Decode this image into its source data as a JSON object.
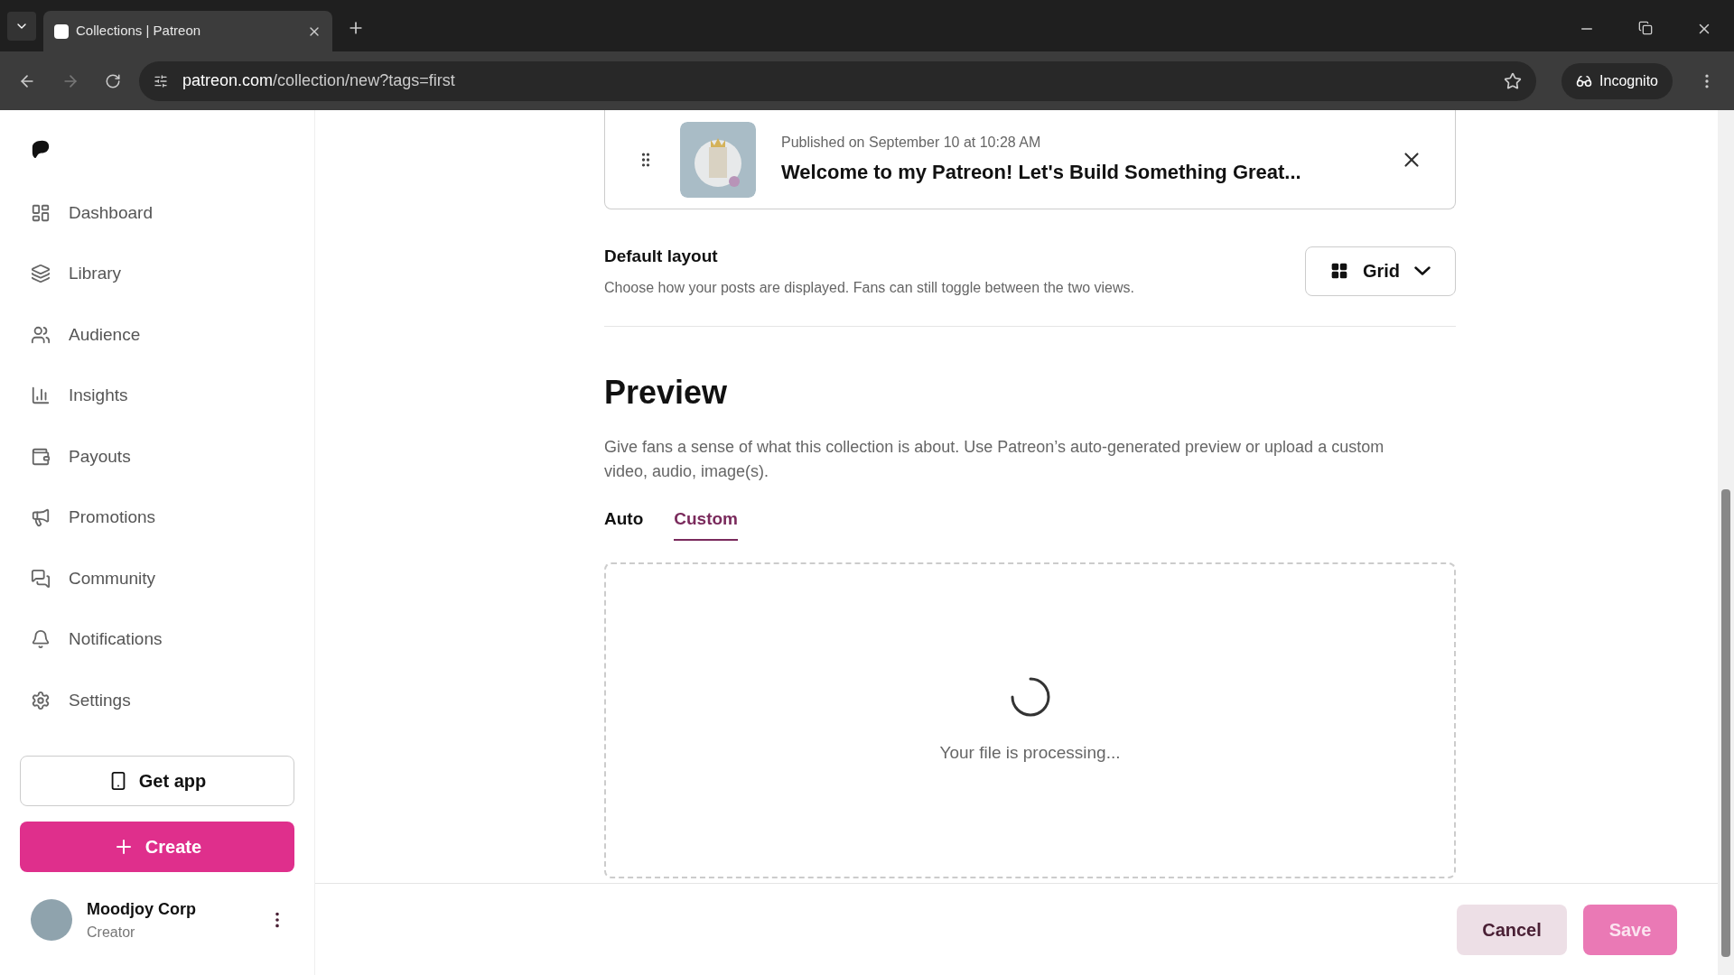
{
  "browser": {
    "tab_title": "Collections | Patreon",
    "url_host": "patreon.com",
    "url_path": "/collection/new?tags=first",
    "profile": "Incognito"
  },
  "sidebar": {
    "items": [
      {
        "label": "Dashboard"
      },
      {
        "label": "Library"
      },
      {
        "label": "Audience"
      },
      {
        "label": "Insights"
      },
      {
        "label": "Payouts"
      },
      {
        "label": "Promotions"
      },
      {
        "label": "Community"
      },
      {
        "label": "Notifications"
      },
      {
        "label": "Settings"
      }
    ],
    "get_app": "Get app",
    "create": "Create",
    "user": {
      "name": "Moodjoy Corp",
      "role": "Creator"
    }
  },
  "post": {
    "meta": "Published on September 10 at 10:28 AM",
    "title": "Welcome to my Patreon! Let's Build Something Great..."
  },
  "default_layout": {
    "title": "Default layout",
    "description": "Choose how your posts are displayed. Fans can still toggle between the two views.",
    "value": "Grid"
  },
  "preview": {
    "title": "Preview",
    "description": "Give fans a sense of what this collection is about. Use Patreon’s auto-generated preview or upload a custom video, audio, image(s).",
    "tabs": [
      {
        "label": "Auto",
        "selected": false
      },
      {
        "label": "Custom",
        "selected": true
      }
    ],
    "status": "Your file is processing..."
  },
  "footer": {
    "cancel": "Cancel",
    "save": "Save"
  }
}
